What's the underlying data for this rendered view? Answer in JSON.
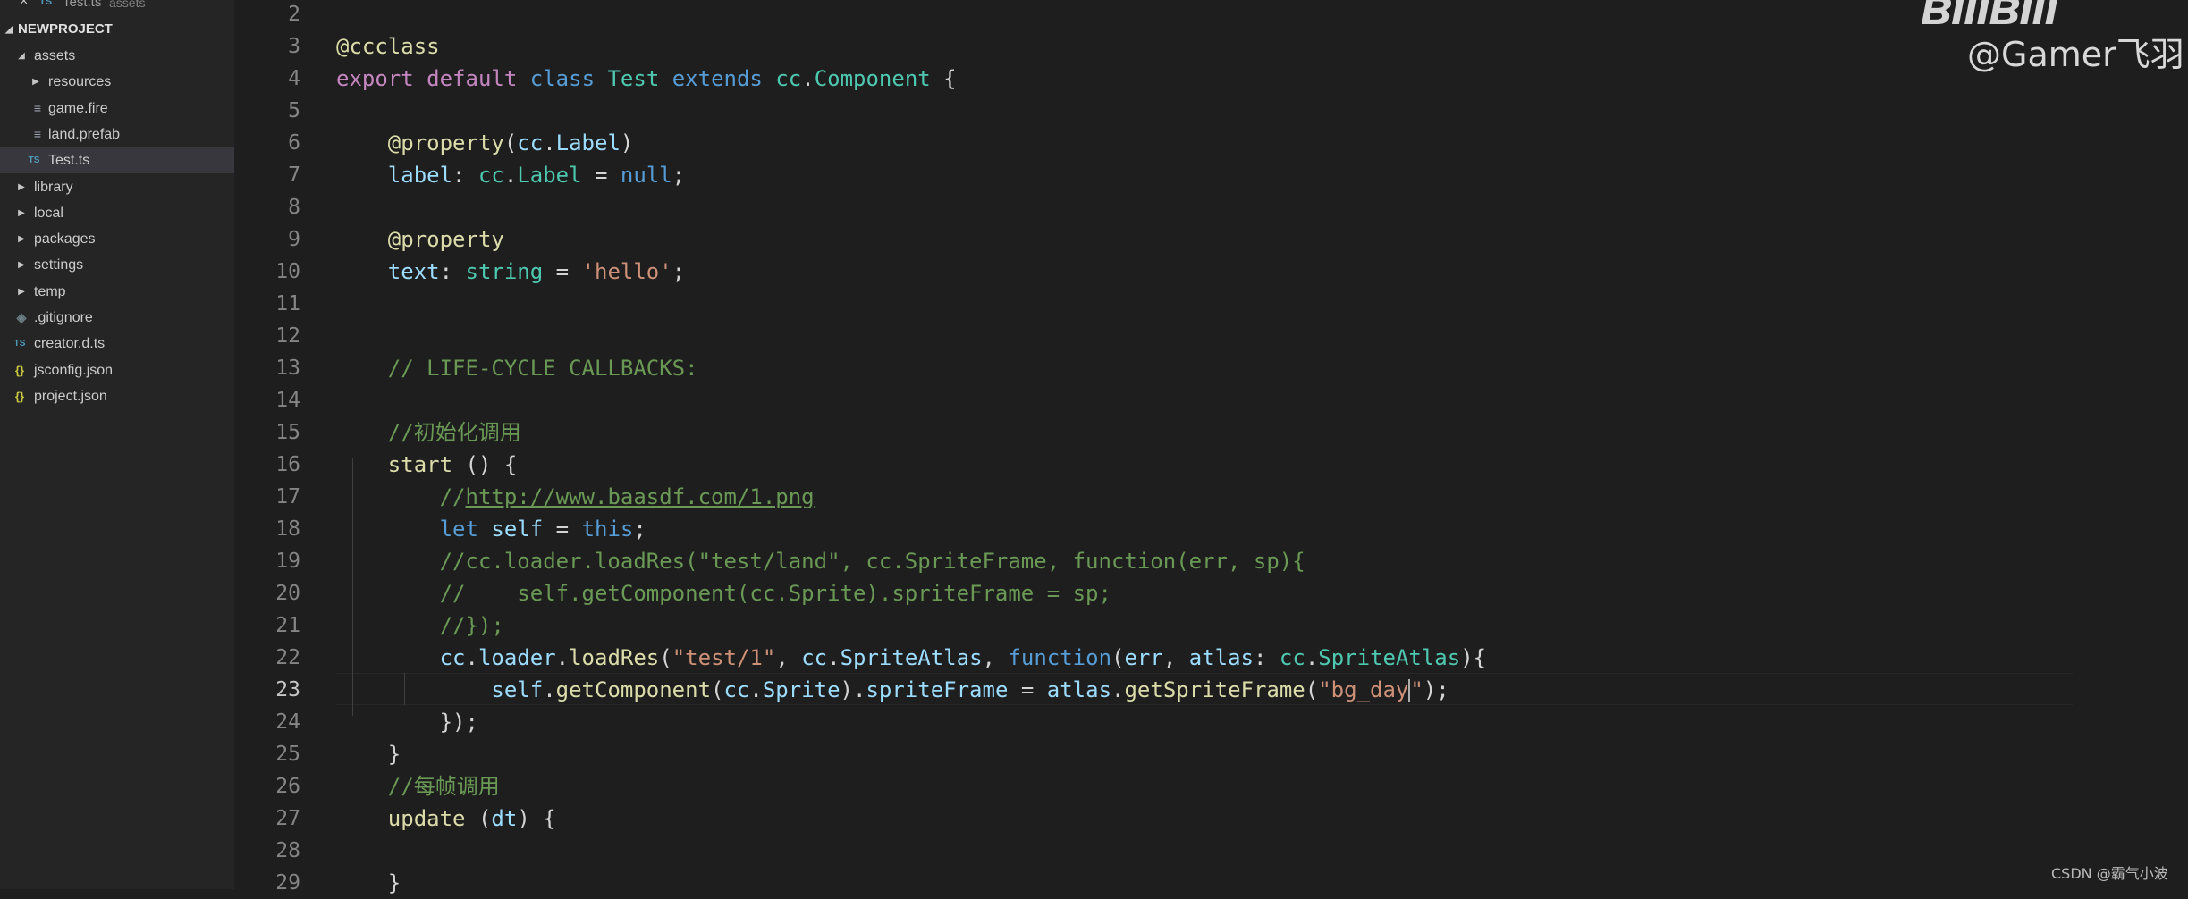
{
  "open_editor": {
    "close_icon": "×",
    "badge": "TS",
    "filename": "Test.ts",
    "description": "assets"
  },
  "explorer": {
    "project_name": "NEWPROJECT",
    "items": [
      {
        "label": "assets",
        "type": "folder",
        "expanded": true,
        "icon": "chevron-down-icon"
      },
      {
        "label": "resources",
        "type": "folder",
        "expanded": false,
        "icon": "chevron-right-icon"
      },
      {
        "label": "game.fire",
        "type": "file",
        "icon": "lines-file-icon"
      },
      {
        "label": "land.prefab",
        "type": "file",
        "icon": "lines-file-icon"
      },
      {
        "label": "Test.ts",
        "type": "file",
        "icon": "ts-file-icon",
        "badge": "TS",
        "selected": true
      },
      {
        "label": "library",
        "type": "folder",
        "expanded": false,
        "icon": "chevron-right-icon"
      },
      {
        "label": "local",
        "type": "folder",
        "expanded": false,
        "icon": "chevron-right-icon"
      },
      {
        "label": "packages",
        "type": "folder",
        "expanded": false,
        "icon": "chevron-right-icon"
      },
      {
        "label": "settings",
        "type": "folder",
        "expanded": false,
        "icon": "chevron-right-icon"
      },
      {
        "label": "temp",
        "type": "folder",
        "expanded": false,
        "icon": "chevron-right-icon"
      },
      {
        "label": ".gitignore",
        "type": "file",
        "icon": "git-file-icon"
      },
      {
        "label": "creator.d.ts",
        "type": "file",
        "icon": "ts-file-icon",
        "badge": "TS"
      },
      {
        "label": "jsconfig.json",
        "type": "file",
        "icon": "json-file-icon",
        "badge": "{}"
      },
      {
        "label": "project.json",
        "type": "file",
        "icon": "json-file-icon",
        "badge": "{}"
      }
    ]
  },
  "editor": {
    "active_line": "23",
    "lines": [
      {
        "num": "2",
        "tokens": []
      },
      {
        "num": "3",
        "tokens": [
          {
            "t": "@ccclass",
            "c": "f"
          }
        ]
      },
      {
        "num": "4",
        "tokens": [
          {
            "t": "export",
            "c": "kc"
          },
          {
            "t": " "
          },
          {
            "t": "default",
            "c": "kc"
          },
          {
            "t": " "
          },
          {
            "t": "class",
            "c": "k"
          },
          {
            "t": " "
          },
          {
            "t": "Test",
            "c": "t"
          },
          {
            "t": " "
          },
          {
            "t": "extends",
            "c": "k"
          },
          {
            "t": " "
          },
          {
            "t": "cc",
            "c": "t"
          },
          {
            "t": "."
          },
          {
            "t": "Component",
            "c": "t"
          },
          {
            "t": " {"
          }
        ]
      },
      {
        "num": "5",
        "tokens": []
      },
      {
        "num": "6",
        "tokens": [
          {
            "t": "    "
          },
          {
            "t": "@property",
            "c": "f"
          },
          {
            "t": "("
          },
          {
            "t": "cc",
            "c": "v"
          },
          {
            "t": "."
          },
          {
            "t": "Label",
            "c": "v"
          },
          {
            "t": ")"
          }
        ]
      },
      {
        "num": "7",
        "tokens": [
          {
            "t": "    "
          },
          {
            "t": "label",
            "c": "v"
          },
          {
            "t": ": "
          },
          {
            "t": "cc",
            "c": "t"
          },
          {
            "t": "."
          },
          {
            "t": "Label",
            "c": "t"
          },
          {
            "t": " = "
          },
          {
            "t": "null",
            "c": "k"
          },
          {
            "t": ";"
          }
        ]
      },
      {
        "num": "8",
        "tokens": []
      },
      {
        "num": "9",
        "tokens": [
          {
            "t": "    "
          },
          {
            "t": "@property",
            "c": "f"
          }
        ]
      },
      {
        "num": "10",
        "tokens": [
          {
            "t": "    "
          },
          {
            "t": "text",
            "c": "v"
          },
          {
            "t": ": "
          },
          {
            "t": "string",
            "c": "t"
          },
          {
            "t": " = "
          },
          {
            "t": "'hello'",
            "c": "s"
          },
          {
            "t": ";"
          }
        ]
      },
      {
        "num": "11",
        "tokens": []
      },
      {
        "num": "12",
        "tokens": []
      },
      {
        "num": "13",
        "tokens": [
          {
            "t": "    "
          },
          {
            "t": "// LIFE-CYCLE CALLBACKS:",
            "c": "c"
          }
        ]
      },
      {
        "num": "14",
        "tokens": []
      },
      {
        "num": "15",
        "tokens": [
          {
            "t": "    "
          },
          {
            "t": "//初始化调用",
            "c": "c"
          }
        ]
      },
      {
        "num": "16",
        "tokens": [
          {
            "t": "    "
          },
          {
            "t": "start",
            "c": "f"
          },
          {
            "t": " () {"
          }
        ]
      },
      {
        "num": "17",
        "tokens": [
          {
            "t": "        "
          },
          {
            "t": "//",
            "c": "c"
          },
          {
            "t": "http://www.baasdf.com/1.png",
            "c": "c",
            "link": true
          }
        ]
      },
      {
        "num": "18",
        "tokens": [
          {
            "t": "        "
          },
          {
            "t": "let",
            "c": "k"
          },
          {
            "t": " "
          },
          {
            "t": "self",
            "c": "v"
          },
          {
            "t": " = "
          },
          {
            "t": "this",
            "c": "k"
          },
          {
            "t": ";"
          }
        ]
      },
      {
        "num": "19",
        "tokens": [
          {
            "t": "        "
          },
          {
            "t": "//cc.loader.loadRes(\"test/land\", cc.SpriteFrame, function(err, sp){",
            "c": "c"
          }
        ]
      },
      {
        "num": "20",
        "tokens": [
          {
            "t": "        "
          },
          {
            "t": "//    self.getComponent(cc.Sprite).spriteFrame = sp;",
            "c": "c"
          }
        ]
      },
      {
        "num": "21",
        "tokens": [
          {
            "t": "        "
          },
          {
            "t": "//});",
            "c": "c"
          }
        ]
      },
      {
        "num": "22",
        "tokens": [
          {
            "t": "        "
          },
          {
            "t": "cc",
            "c": "v"
          },
          {
            "t": "."
          },
          {
            "t": "loader",
            "c": "v"
          },
          {
            "t": "."
          },
          {
            "t": "loadRes",
            "c": "f"
          },
          {
            "t": "("
          },
          {
            "t": "\"test/1\"",
            "c": "s"
          },
          {
            "t": ", "
          },
          {
            "t": "cc",
            "c": "v"
          },
          {
            "t": "."
          },
          {
            "t": "SpriteAtlas",
            "c": "v"
          },
          {
            "t": ", "
          },
          {
            "t": "function",
            "c": "k"
          },
          {
            "t": "("
          },
          {
            "t": "err",
            "c": "v"
          },
          {
            "t": ", "
          },
          {
            "t": "atlas",
            "c": "v"
          },
          {
            "t": ": "
          },
          {
            "t": "cc",
            "c": "t"
          },
          {
            "t": "."
          },
          {
            "t": "SpriteAtlas",
            "c": "t"
          },
          {
            "t": "){"
          }
        ]
      },
      {
        "num": "23",
        "tokens": [
          {
            "t": "            "
          },
          {
            "t": "self",
            "c": "v"
          },
          {
            "t": "."
          },
          {
            "t": "getComponent",
            "c": "f"
          },
          {
            "t": "("
          },
          {
            "t": "cc",
            "c": "v"
          },
          {
            "t": "."
          },
          {
            "t": "Sprite",
            "c": "v"
          },
          {
            "t": ")."
          },
          {
            "t": "spriteFrame",
            "c": "v"
          },
          {
            "t": " = "
          },
          {
            "t": "atlas",
            "c": "v"
          },
          {
            "t": "."
          },
          {
            "t": "getSpriteFrame",
            "c": "f"
          },
          {
            "t": "("
          },
          {
            "t": "\"bg_day",
            "c": "s"
          },
          {
            "cursor": true
          },
          {
            "t": "\"",
            "c": "s"
          },
          {
            "t": ");"
          }
        ]
      },
      {
        "num": "24",
        "tokens": [
          {
            "t": "        });"
          }
        ]
      },
      {
        "num": "25",
        "tokens": [
          {
            "t": "    }"
          }
        ]
      },
      {
        "num": "26",
        "tokens": [
          {
            "t": "    "
          },
          {
            "t": "//每帧调用",
            "c": "c"
          }
        ]
      },
      {
        "num": "27",
        "tokens": [
          {
            "t": "    "
          },
          {
            "t": "update",
            "c": "f"
          },
          {
            "t": " ("
          },
          {
            "t": "dt",
            "c": "v"
          },
          {
            "t": ") {"
          }
        ]
      },
      {
        "num": "28",
        "tokens": []
      },
      {
        "num": "29",
        "tokens": [
          {
            "t": "    }"
          }
        ]
      }
    ]
  },
  "watermark": {
    "logo": "bilibili",
    "user": "@Gamer飞羽"
  },
  "credit": "CSDN @霸气小波",
  "colors": {
    "background": "#1e1e1e",
    "sidebar": "#252526",
    "keyword": "#569cd6",
    "control_keyword": "#c586c0",
    "type": "#4ec9b0",
    "variable": "#9cdcfe",
    "function": "#dcdcaa",
    "string": "#ce9178",
    "comment": "#6a9955"
  }
}
